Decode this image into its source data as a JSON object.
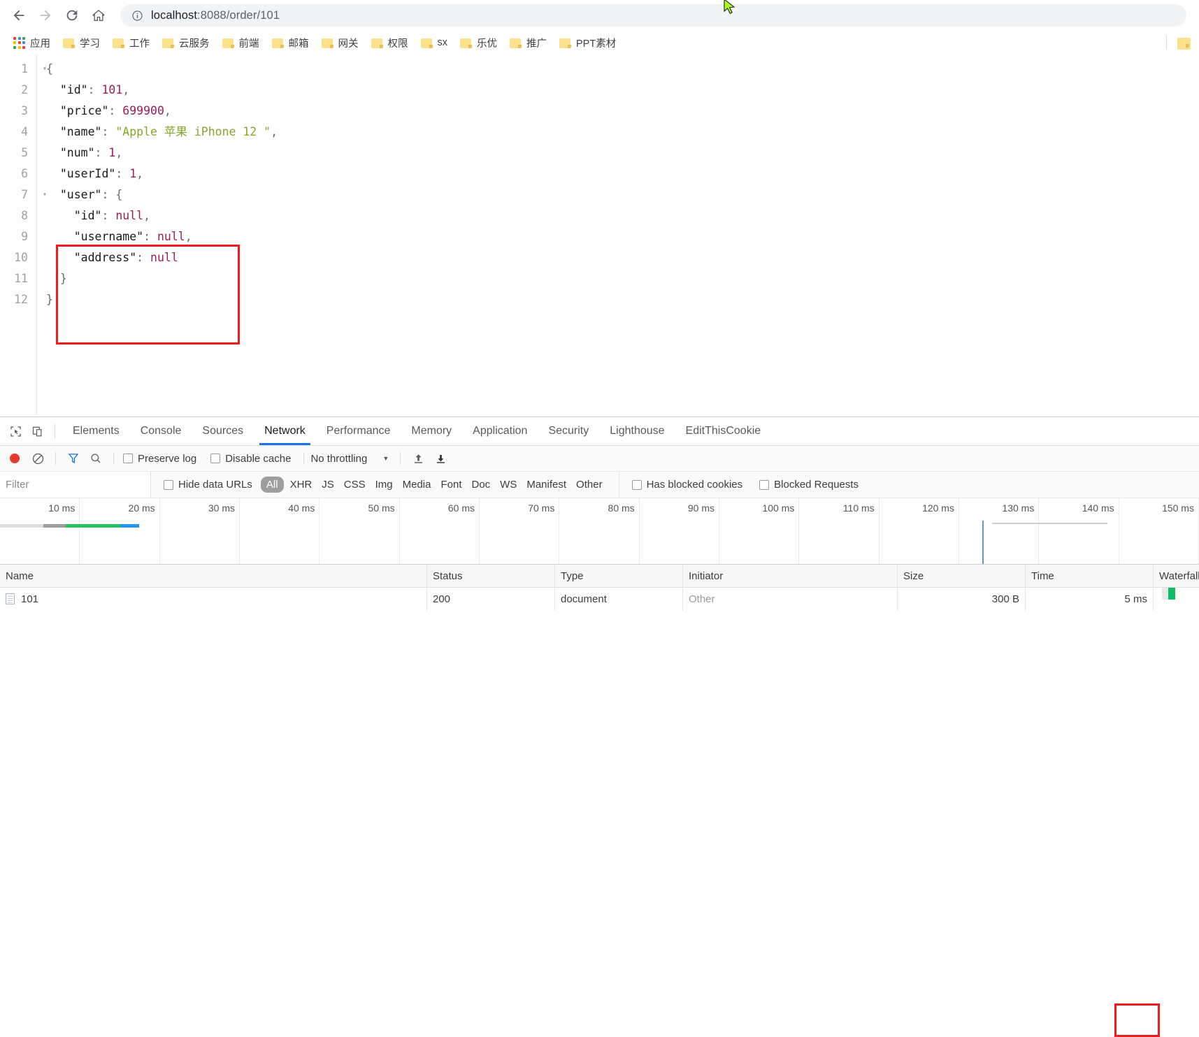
{
  "browser": {
    "nav": {
      "back_icon": "back-arrow-icon",
      "forward_icon": "forward-arrow-icon",
      "reload_icon": "reload-icon",
      "home_icon": "home-icon"
    },
    "omnibox": {
      "site_info_icon": "info-circle-icon",
      "url_host": "localhost",
      "url_rest": ":8088/order/101",
      "url_full": "localhost:8088/order/101"
    },
    "bookmarks": {
      "apps_label": "应用",
      "items": [
        {
          "label": "学习",
          "icon": "folder-icon"
        },
        {
          "label": "工作",
          "icon": "folder-icon"
        },
        {
          "label": "云服务",
          "icon": "folder-icon"
        },
        {
          "label": "前端",
          "icon": "folder-icon"
        },
        {
          "label": "邮箱",
          "icon": "folder-icon"
        },
        {
          "label": "网关",
          "icon": "folder-icon"
        },
        {
          "label": "权限",
          "icon": "folder-icon"
        },
        {
          "label": "sx",
          "icon": "folder-icon"
        },
        {
          "label": "乐优",
          "icon": "folder-icon"
        },
        {
          "label": "推广",
          "icon": "folder-icon"
        },
        {
          "label": "PPT素材",
          "icon": "folder-icon"
        }
      ],
      "overflow_icon": "folder-icon"
    }
  },
  "json_viewer": {
    "lines": [
      {
        "n": "1",
        "fold": "▾",
        "tokens": [
          {
            "t": "{",
            "c": "k-punc"
          }
        ]
      },
      {
        "n": "2",
        "fold": "",
        "tokens": [
          {
            "t": "  \"id\"",
            "c": "k-key"
          },
          {
            "t": ": ",
            "c": "k-punc"
          },
          {
            "t": "101",
            "c": "k-num"
          },
          {
            "t": ",",
            "c": "k-punc"
          }
        ]
      },
      {
        "n": "3",
        "fold": "",
        "tokens": [
          {
            "t": "  \"price\"",
            "c": "k-key"
          },
          {
            "t": ": ",
            "c": "k-punc"
          },
          {
            "t": "699900",
            "c": "k-num"
          },
          {
            "t": ",",
            "c": "k-punc"
          }
        ]
      },
      {
        "n": "4",
        "fold": "",
        "tokens": [
          {
            "t": "  \"name\"",
            "c": "k-key"
          },
          {
            "t": ": ",
            "c": "k-punc"
          },
          {
            "t": "\"Apple 苹果 iPhone 12 \"",
            "c": "k-str"
          },
          {
            "t": ",",
            "c": "k-punc"
          }
        ]
      },
      {
        "n": "5",
        "fold": "",
        "tokens": [
          {
            "t": "  \"num\"",
            "c": "k-key"
          },
          {
            "t": ": ",
            "c": "k-punc"
          },
          {
            "t": "1",
            "c": "k-num"
          },
          {
            "t": ",",
            "c": "k-punc"
          }
        ]
      },
      {
        "n": "6",
        "fold": "",
        "tokens": [
          {
            "t": "  \"userId\"",
            "c": "k-key"
          },
          {
            "t": ": ",
            "c": "k-punc"
          },
          {
            "t": "1",
            "c": "k-num"
          },
          {
            "t": ",",
            "c": "k-punc"
          }
        ]
      },
      {
        "n": "7",
        "fold": "▾",
        "tokens": [
          {
            "t": "  \"user\"",
            "c": "k-key"
          },
          {
            "t": ": {",
            "c": "k-punc"
          }
        ]
      },
      {
        "n": "8",
        "fold": "",
        "tokens": [
          {
            "t": "    \"id\"",
            "c": "k-key"
          },
          {
            "t": ": ",
            "c": "k-punc"
          },
          {
            "t": "null",
            "c": "k-null"
          },
          {
            "t": ",",
            "c": "k-punc"
          }
        ]
      },
      {
        "n": "9",
        "fold": "",
        "tokens": [
          {
            "t": "    \"username\"",
            "c": "k-key"
          },
          {
            "t": ": ",
            "c": "k-punc"
          },
          {
            "t": "null",
            "c": "k-null"
          },
          {
            "t": ",",
            "c": "k-punc"
          }
        ]
      },
      {
        "n": "10",
        "fold": "",
        "tokens": [
          {
            "t": "    \"address\"",
            "c": "k-key"
          },
          {
            "t": ": ",
            "c": "k-punc"
          },
          {
            "t": "null",
            "c": "k-null"
          }
        ]
      },
      {
        "n": "11",
        "fold": "",
        "tokens": [
          {
            "t": "  }",
            "c": "k-punc"
          }
        ]
      },
      {
        "n": "12",
        "fold": "",
        "tokens": [
          {
            "t": "}",
            "c": "k-punc"
          }
        ]
      }
    ],
    "payload": {
      "id": 101,
      "price": 699900,
      "name": "Apple 苹果 iPhone 12 ",
      "num": 1,
      "userId": 1,
      "user": {
        "id": null,
        "username": null,
        "address": null
      }
    },
    "highlight_color": "#f21a1a"
  },
  "devtools": {
    "inspect_icon": "inspect-element-icon",
    "device_icon": "device-toolbar-icon",
    "tabs": [
      {
        "label": "Elements",
        "active": false
      },
      {
        "label": "Console",
        "active": false
      },
      {
        "label": "Sources",
        "active": false
      },
      {
        "label": "Network",
        "active": true
      },
      {
        "label": "Performance",
        "active": false
      },
      {
        "label": "Memory",
        "active": false
      },
      {
        "label": "Application",
        "active": false
      },
      {
        "label": "Security",
        "active": false
      },
      {
        "label": "Lighthouse",
        "active": false
      },
      {
        "label": "EditThisCookie",
        "active": false
      }
    ],
    "toolbar": {
      "record_icon": "record-stop-icon",
      "clear_icon": "clear-network-icon",
      "filter_icon": "filter-funnel-icon",
      "search_icon": "search-icon",
      "preserve_log": {
        "label": "Preserve log",
        "checked": false
      },
      "disable_cache": {
        "label": "Disable cache",
        "checked": false
      },
      "throttling": {
        "value": "No throttling",
        "caret_icon": "chevron-down-icon"
      },
      "import_icon": "import-har-icon",
      "export_icon": "export-har-icon"
    },
    "filterbar": {
      "filter_placeholder": "Filter",
      "filter_value": "",
      "hide_data_urls": {
        "label": "Hide data URLs",
        "checked": false
      },
      "types": [
        "All",
        "XHR",
        "JS",
        "CSS",
        "Img",
        "Media",
        "Font",
        "Doc",
        "WS",
        "Manifest",
        "Other"
      ],
      "selected_type": "All",
      "has_blocked_cookies": {
        "label": "Has blocked cookies",
        "checked": false
      },
      "blocked_requests": {
        "label": "Blocked Requests",
        "checked": false
      }
    },
    "overview": {
      "ticks": [
        "10 ms",
        "20 ms",
        "30 ms",
        "40 ms",
        "50 ms",
        "60 ms",
        "70 ms",
        "80 ms",
        "90 ms",
        "100 ms",
        "110 ms",
        "120 ms",
        "130 ms",
        "140 ms",
        "150 ms"
      ],
      "dcl_marker_ms": 128,
      "request_bar_colors": [
        "#dedede",
        "#9e9e9e",
        "#2bc15e",
        "#2196f3"
      ]
    },
    "table": {
      "columns": [
        "Name",
        "Status",
        "Type",
        "Initiator",
        "Size",
        "Time",
        "Waterfall"
      ],
      "rows": [
        {
          "icon": "document-icon",
          "name": "101",
          "status": "200",
          "type": "document",
          "initiator": "Other",
          "size": "300 B",
          "time": "5 ms",
          "waterfall_color": "#0cbd63"
        }
      ],
      "time_highlight_color": "#f21a1a"
    }
  },
  "cursor": {
    "icon": "mouse-pointer-icon",
    "color": "#aaff20"
  }
}
